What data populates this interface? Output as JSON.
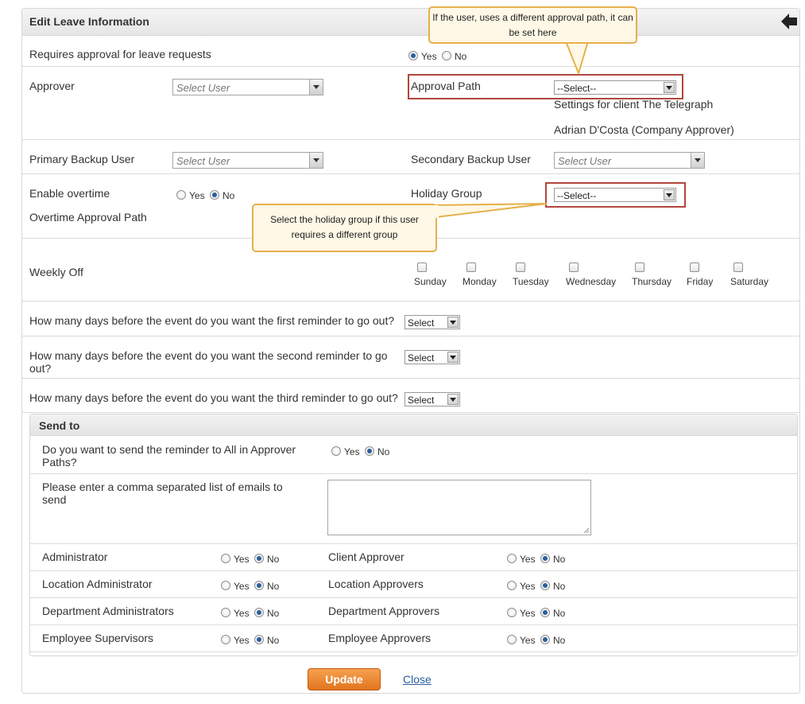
{
  "panel": {
    "title": "Edit Leave Information",
    "back_icon": "back-arrow-icon"
  },
  "callouts": {
    "approval_path": "If the user, uses a different approval path, it can be set here",
    "holiday_group": "Select the holiday group if this user requires a different group"
  },
  "requires_approval": {
    "label": "Requires approval for leave requests",
    "yes": "Yes",
    "no": "No",
    "selected": "Yes"
  },
  "approver": {
    "label": "Approver",
    "placeholder": "Select User"
  },
  "approval_path": {
    "label": "Approval Path",
    "value": "--Select--",
    "settings_note": "Settings for client The Telegraph",
    "company_approver": "Adrian D'Costa (Company Approver)"
  },
  "primary_backup": {
    "label": "Primary Backup User",
    "placeholder": "Select User"
  },
  "secondary_backup": {
    "label": "Secondary Backup User",
    "placeholder": "Select User"
  },
  "overtime": {
    "label": "Enable overtime",
    "yes": "Yes",
    "no": "No",
    "selected": "No",
    "approval_path_label": "Overtime Approval Path"
  },
  "holiday_group": {
    "label": "Holiday Group",
    "value": "--Select--"
  },
  "weekly_off": {
    "label": "Weekly Off",
    "days": [
      "Sunday",
      "Monday",
      "Tuesday",
      "Wednesday",
      "Thursday",
      "Friday",
      "Saturday"
    ]
  },
  "reminders": [
    {
      "label": "How many days before the event do you want the first reminder to go out?",
      "value": "Select"
    },
    {
      "label": "How many days before the event do you want the second reminder to go out?",
      "value": "Select"
    },
    {
      "label": "How many days before the event do you want the third reminder to go out?",
      "value": "Select"
    }
  ],
  "send_to": {
    "title": "Send to",
    "all_in_paths": {
      "label": "Do you want to send the reminder to All in Approver Paths?",
      "yes": "Yes",
      "no": "No",
      "selected": "No"
    },
    "emails_label": "Please enter a comma separated list of emails to send",
    "roles": [
      {
        "label": "Administrator",
        "yes": "Yes",
        "no": "No",
        "selected": "No"
      },
      {
        "label": "Client Approver",
        "yes": "Yes",
        "no": "No",
        "selected": "No"
      },
      {
        "label": "Location Administrator",
        "yes": "Yes",
        "no": "No",
        "selected": "No"
      },
      {
        "label": "Location Approvers",
        "yes": "Yes",
        "no": "No",
        "selected": "No"
      },
      {
        "label": "Department Administrators",
        "yes": "Yes",
        "no": "No",
        "selected": "No"
      },
      {
        "label": "Department Approvers",
        "yes": "Yes",
        "no": "No",
        "selected": "No"
      },
      {
        "label": "Employee Supervisors",
        "yes": "Yes",
        "no": "No",
        "selected": "No"
      },
      {
        "label": "Employee Approvers",
        "yes": "Yes",
        "no": "No",
        "selected": "No"
      }
    ]
  },
  "actions": {
    "update": "Update",
    "close": "Close"
  },
  "colors": {
    "accent_button": "#e8822b",
    "highlight_border": "#b0473d",
    "callout_border": "#e5b04c",
    "link": "#2a5e9c"
  }
}
